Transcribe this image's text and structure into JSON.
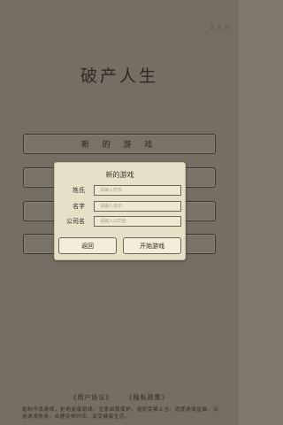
{
  "version": "3.0.0",
  "app_title": "破产人生",
  "menu": {
    "new_game_label": "新 的 游 戏",
    "hidden_buttons": [
      "",
      "",
      ""
    ]
  },
  "dialog": {
    "title": "新的游戏",
    "fields": [
      {
        "label": "姓氏",
        "placeholder": "请输入姓氏",
        "value": ""
      },
      {
        "label": "名字",
        "placeholder": "请输入名字",
        "value": ""
      },
      {
        "label": "公司名",
        "placeholder": "请输入公司名",
        "value": ""
      }
    ],
    "back_label": "返回",
    "start_label": "开始游戏"
  },
  "footer": {
    "user_agreement": "《用户协议》",
    "privacy_policy": "《隐私政策》",
    "notice": "抵制不良游戏，拒绝盗版游戏。注意自我保护，谨防受骗上当。适度游戏益脑，沉迷游戏伤身。合理安排时间，享受健康生活。"
  },
  "colors": {
    "background": "#807a6d",
    "dialog_bg": "#e8dfc8",
    "text": "#2c2822"
  }
}
